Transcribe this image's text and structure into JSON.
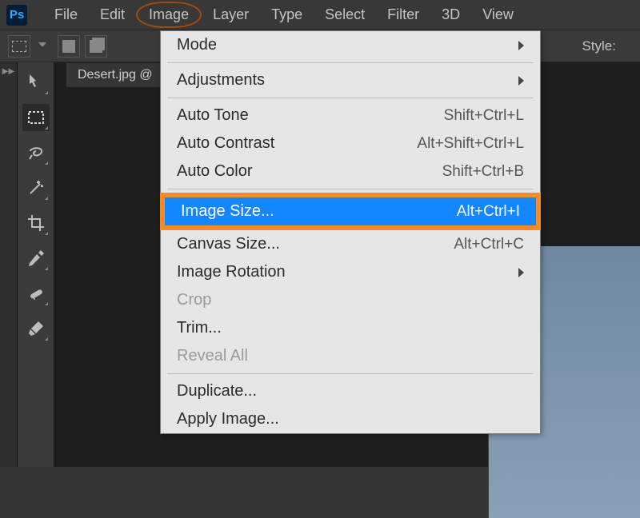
{
  "app": {
    "logo": "Ps",
    "style_label": "Style:"
  },
  "menubar": [
    "File",
    "Edit",
    "Image",
    "Layer",
    "Type",
    "Select",
    "Filter",
    "3D",
    "View"
  ],
  "circled_menu_index": 2,
  "document": {
    "tab_label": "Desert.jpg @"
  },
  "dropdown": {
    "groups": [
      [
        {
          "label": "Mode",
          "shortcut": "",
          "submenu": true,
          "disabled": false,
          "selected": false
        },
        {
          "sep": true
        },
        {
          "label": "Adjustments",
          "shortcut": "",
          "submenu": true,
          "disabled": false,
          "selected": false
        }
      ],
      [
        {
          "label": "Auto Tone",
          "shortcut": "Shift+Ctrl+L",
          "submenu": false,
          "disabled": false,
          "selected": false
        },
        {
          "label": "Auto Contrast",
          "shortcut": "Alt+Shift+Ctrl+L",
          "submenu": false,
          "disabled": false,
          "selected": false
        },
        {
          "label": "Auto Color",
          "shortcut": "Shift+Ctrl+B",
          "submenu": false,
          "disabled": false,
          "selected": false
        }
      ],
      [
        {
          "label": "Image Size...",
          "shortcut": "Alt+Ctrl+I",
          "submenu": false,
          "disabled": false,
          "selected": true
        },
        {
          "label": "Canvas Size...",
          "shortcut": "Alt+Ctrl+C",
          "submenu": false,
          "disabled": false,
          "selected": false
        },
        {
          "label": "Image Rotation",
          "shortcut": "",
          "submenu": true,
          "disabled": false,
          "selected": false
        },
        {
          "label": "Crop",
          "shortcut": "",
          "submenu": false,
          "disabled": true,
          "selected": false
        },
        {
          "label": "Trim...",
          "shortcut": "",
          "submenu": false,
          "disabled": false,
          "selected": false
        },
        {
          "label": "Reveal All",
          "shortcut": "",
          "submenu": false,
          "disabled": true,
          "selected": false
        }
      ],
      [
        {
          "label": "Duplicate...",
          "shortcut": "",
          "submenu": false,
          "disabled": false,
          "selected": false
        },
        {
          "label": "Apply Image...",
          "shortcut": "",
          "submenu": false,
          "disabled": false,
          "selected": false
        }
      ]
    ]
  },
  "tools": [
    {
      "name": "move-tool"
    },
    {
      "name": "rectangular-marquee-tool",
      "active": true
    },
    {
      "name": "lasso-tool"
    },
    {
      "name": "magic-wand-tool"
    },
    {
      "name": "crop-tool"
    },
    {
      "name": "eyedropper-tool"
    },
    {
      "name": "spot-healing-brush-tool"
    },
    {
      "name": "brush-tool"
    }
  ]
}
